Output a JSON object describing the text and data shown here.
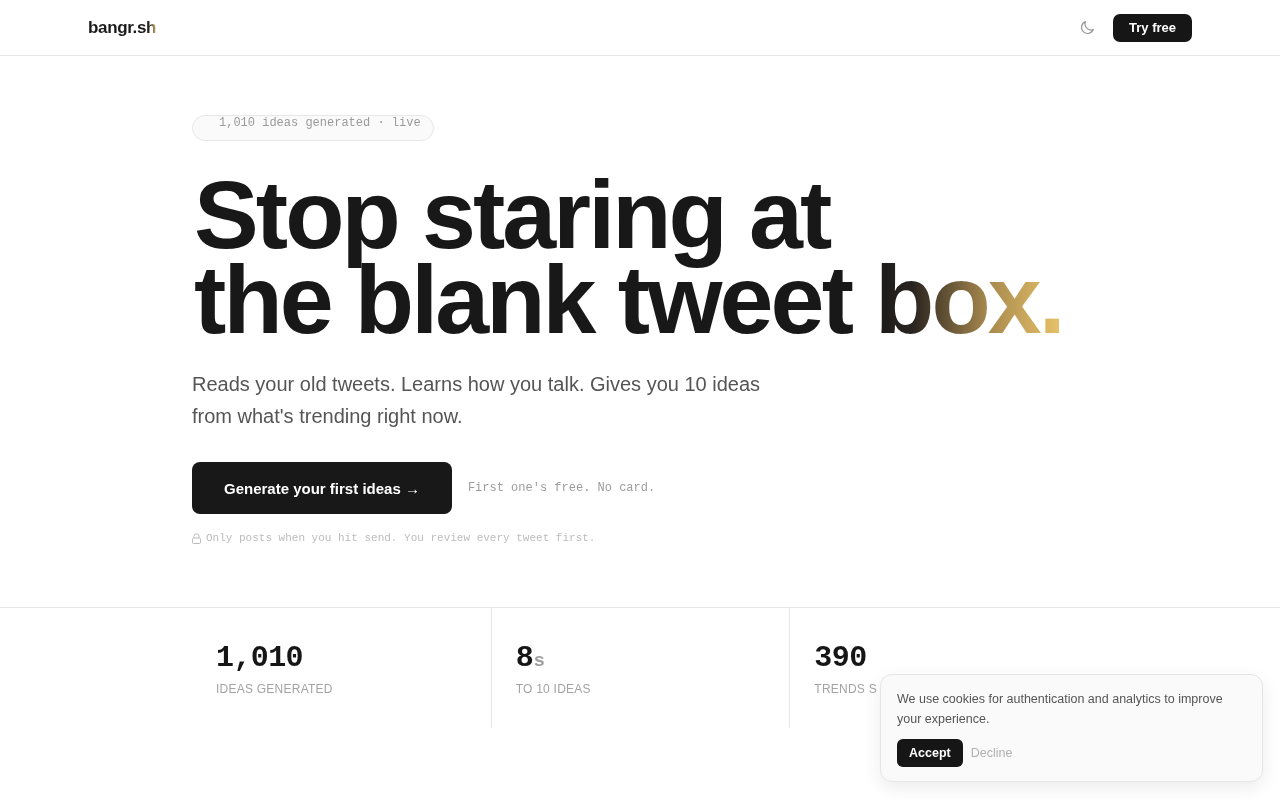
{
  "header": {
    "logo": "bangr.sh",
    "cta": "Try free"
  },
  "hero": {
    "badge": "1,010 ideas generated · live",
    "headline": {
      "lines": [
        "Stop staring at",
        "the blank tweet"
      ],
      "accent": "box."
    },
    "subtitle": "Reads your old tweets. Learns how you talk. Gives you 10 ideas from what's trending right now.",
    "cta": "Generate your first ideas →",
    "cta_note": "First one's free. No card.",
    "privacy_note": "Only posts when you hit send. You review every tweet first."
  },
  "stats": [
    {
      "value": "1,010",
      "label": "IDEAS GENERATED"
    },
    {
      "value": "8",
      "unit": "s",
      "label": "TO 10 IDEAS"
    },
    {
      "value": "390",
      "label": "TRENDS S"
    }
  ],
  "cookie_banner": {
    "message": "We use cookies for authentication and analytics to improve your experience.",
    "buttons": [
      {
        "label": "Accept",
        "kind": "primary"
      },
      {
        "label": "Decline",
        "kind": "secondary"
      }
    ]
  }
}
